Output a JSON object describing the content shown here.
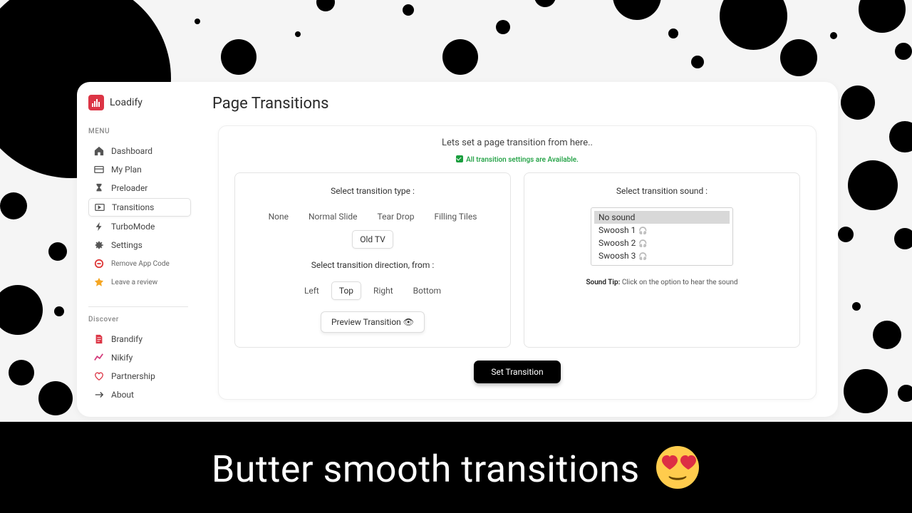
{
  "brand": {
    "name": "Loadify"
  },
  "menu": {
    "label": "MENU",
    "items": [
      {
        "label": "Dashboard",
        "icon": "home"
      },
      {
        "label": "My Plan",
        "icon": "card"
      },
      {
        "label": "Preloader",
        "icon": "hourglass"
      },
      {
        "label": "Transitions",
        "icon": "transition",
        "active": true
      },
      {
        "label": "TurboMode",
        "icon": "bolt"
      },
      {
        "label": "Settings",
        "icon": "gear"
      }
    ],
    "extra": [
      {
        "label": "Remove App Code",
        "icon": "remove",
        "color": "#d33"
      },
      {
        "label": "Leave a review",
        "icon": "star",
        "color": "#f5a623"
      }
    ]
  },
  "discover": {
    "label": "Discover",
    "items": [
      {
        "label": "Brandify",
        "icon": "doc",
        "color": "#dc3545"
      },
      {
        "label": "Nikify",
        "icon": "chart",
        "color": "#d33a7a"
      },
      {
        "label": "Partnership",
        "icon": "heart",
        "color": "#dc3545"
      },
      {
        "label": "About",
        "icon": "about",
        "color": "#444"
      }
    ]
  },
  "page": {
    "title": "Page Transitions",
    "intro": "Lets set a page transition from here..",
    "available": "All transition settings are Available."
  },
  "type_panel": {
    "label": "Select transition type :",
    "options": [
      "None",
      "Normal Slide",
      "Tear Drop",
      "Filling Tiles",
      "Old TV"
    ],
    "selected": "Old TV"
  },
  "direction_panel": {
    "label": "Select transition direction, from :",
    "options": [
      "Left",
      "Top",
      "Right",
      "Bottom"
    ],
    "selected": "Top"
  },
  "preview_label": "Preview Transition  👁",
  "sound_panel": {
    "label": "Select transition sound :",
    "options": [
      "No sound",
      "Swoosh 1",
      "Swoosh 2",
      "Swoosh 3"
    ],
    "selected": "No sound",
    "tip_label": "Sound Tip:",
    "tip_text": " Click on the option to hear the sound"
  },
  "set_label": "Set Transition",
  "footer": "Butter smooth transitions"
}
